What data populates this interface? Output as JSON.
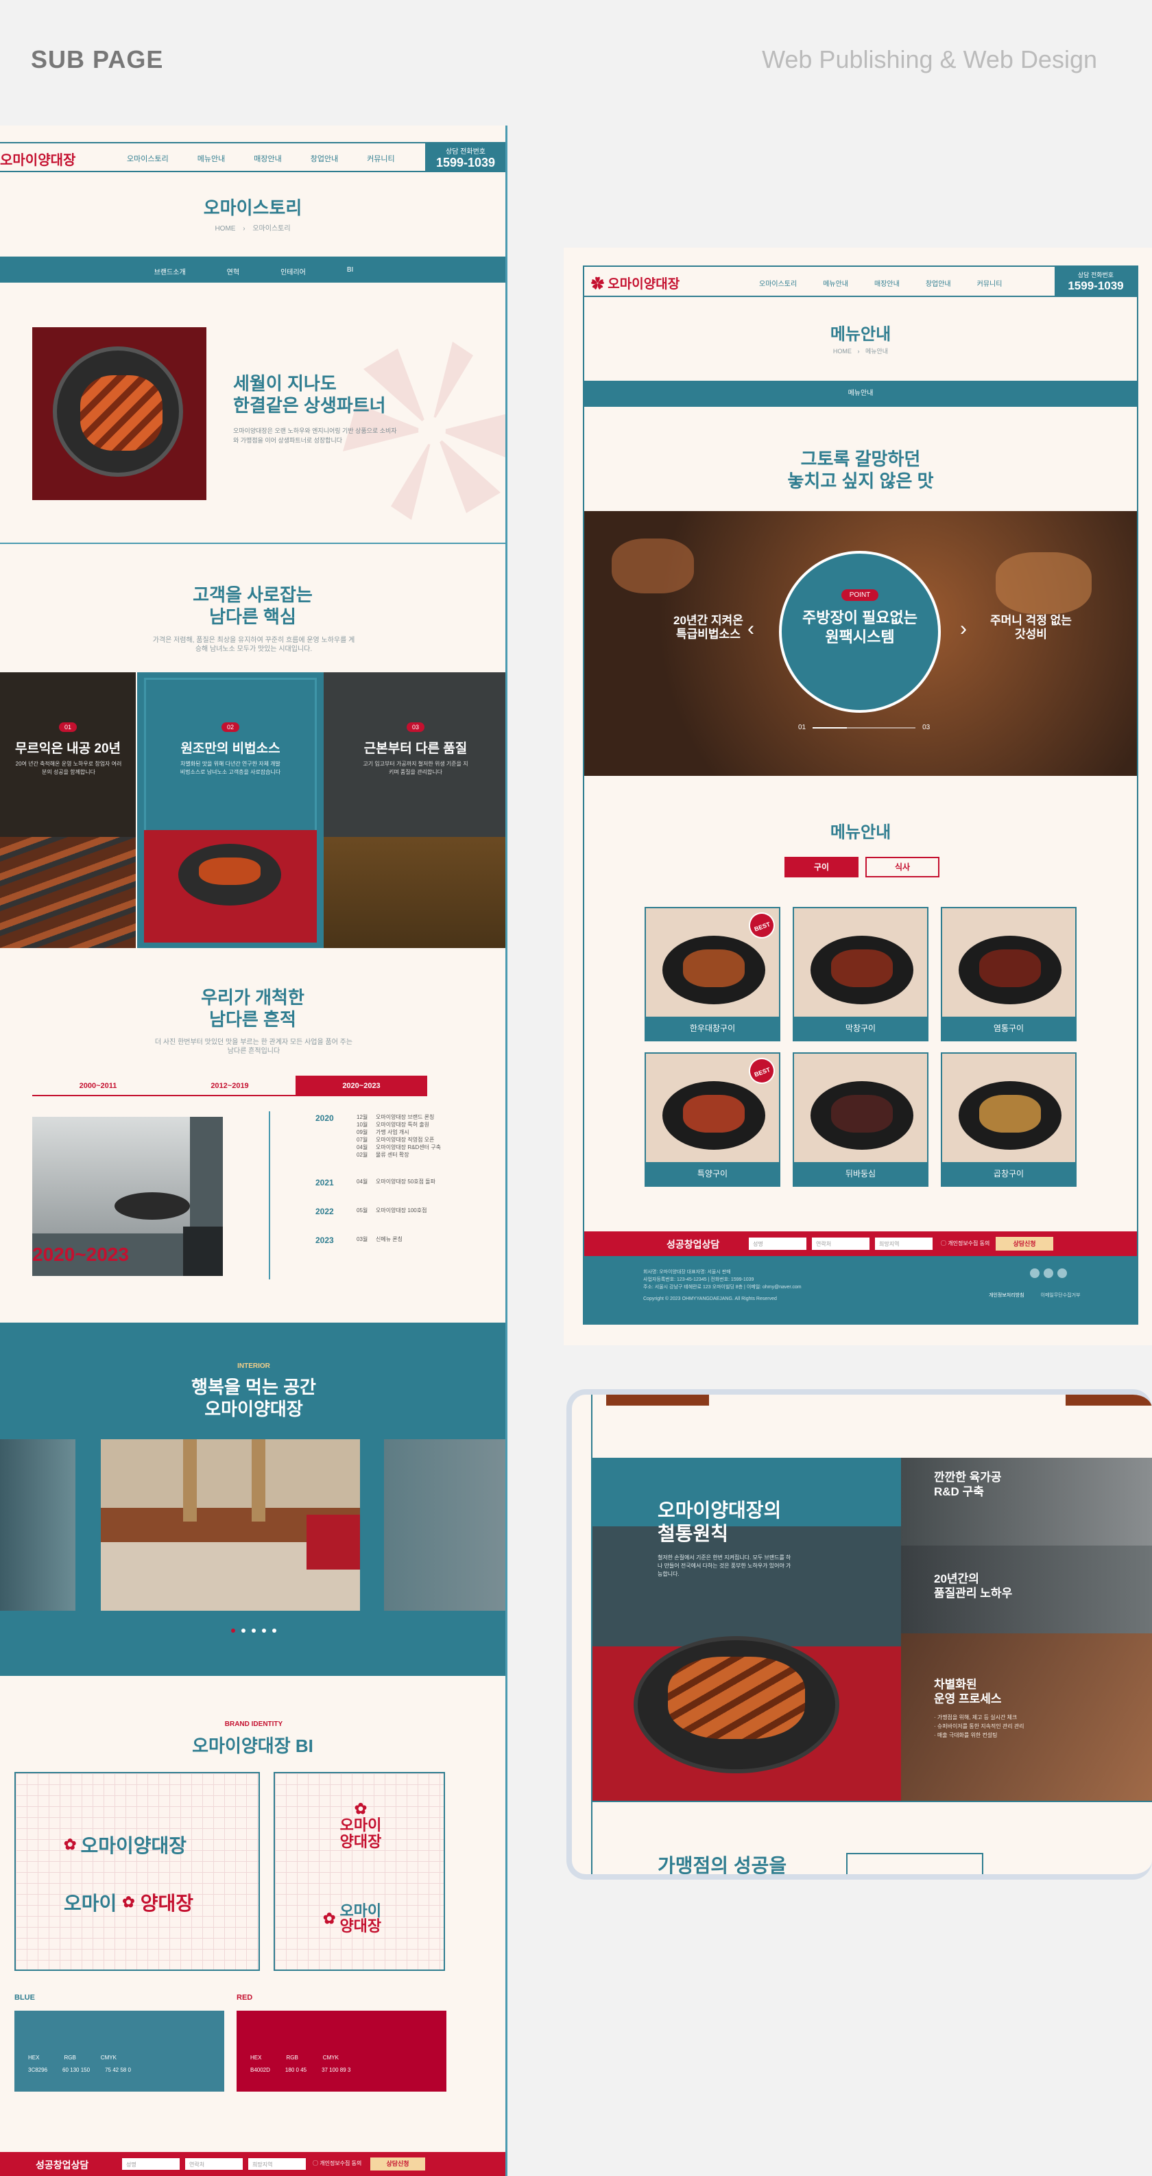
{
  "header": {
    "left": "SUB PAGE",
    "right": "Web Publishing & Web Design"
  },
  "nav": {
    "logo": "오마이양대장",
    "menu": [
      "오마이스토리",
      "메뉴안내",
      "매장안내",
      "창업안내",
      "커뮤니티"
    ],
    "call_label": "상담 전화번호",
    "call_number": "1599-1039"
  },
  "story": {
    "title": "오마이스토리",
    "breadcrumb": [
      "HOME",
      "오마이스토리"
    ],
    "tabs": [
      "브랜드소개",
      "연혁",
      "인테리어",
      "BI"
    ],
    "intro_heading": [
      "세월이 지나도",
      "한결같은 상생파트너"
    ],
    "intro_text": "오마이양대장은 오랜 노하우와 엔지니어링 기반 상품으로 소비자와 가맹점을 이어 상생파트너로 성장합니다"
  },
  "core": {
    "heading": [
      "고객을 사로잡는",
      "남다른 핵심"
    ],
    "desc": "가격은 저렴해, 품질은 최상을 유지하여 꾸준히 흐름에 운영 노하우를 계승해 남녀노소 모두가 맛있는 시대입니다.",
    "cards": [
      {
        "num": "01",
        "title": "무르익은 내공 20년",
        "text": "20여 년간 축적해온 운영 노하우로 창업자 여러분의 성공을 함께합니다"
      },
      {
        "num": "02",
        "title": "원조만의 비법소스",
        "text": "차별화된 맛을 위해 다년간 연구한 자체 개발 비법소스로 남녀노소 고객층을 사로잡습니다"
      },
      {
        "num": "03",
        "title": "근본부터 다른 품질",
        "text": "고기 입고부터 가공까지 철저한 위생 기준을 지키며 품질을 관리합니다"
      }
    ]
  },
  "history": {
    "heading": [
      "우리가 개척한",
      "남다른 흔적"
    ],
    "desc": "더 사진 한번부터 맛있던 맛을 부르는 한 관계자 모든 사업을 품어 주는 남다른 흔적입니다",
    "tabs": [
      "2000~2011",
      "2012~2019",
      "2020~2023"
    ],
    "active_tab": 2,
    "period": "2020~2023",
    "years": [
      {
        "year": "2020",
        "items": [
          {
            "m": "12월",
            "t": "오마이양대장 브랜드 론칭"
          },
          {
            "m": "10월",
            "t": "오마이양대장 특허 출원"
          },
          {
            "m": "09월",
            "t": "가맹 사업 개시"
          },
          {
            "m": "07월",
            "t": "오마이양대장 직영점 오픈"
          },
          {
            "m": "04월",
            "t": "오마이양대장 R&D센터 구축"
          },
          {
            "m": "02월",
            "t": "물류 센터 확장"
          }
        ]
      },
      {
        "year": "2021",
        "items": [
          {
            "m": "04월",
            "t": "오마이양대장 50호점 돌파"
          }
        ]
      },
      {
        "year": "2022",
        "items": [
          {
            "m": "05월",
            "t": "오마이양대장 100호점"
          }
        ]
      },
      {
        "year": "2023",
        "items": [
          {
            "m": "03월",
            "t": "신메뉴 론칭"
          }
        ]
      }
    ]
  },
  "interior": {
    "eyebrow": "INTERIOR",
    "heading": [
      "행복을 먹는 공간",
      "오마이양대장"
    ],
    "dots": 5,
    "active_dot": 0
  },
  "bi": {
    "eyebrow": "BRAND IDENTITY",
    "heading": "오마이양대장 BI",
    "logo_a": "오마이양대장",
    "logo_b1": "오마이",
    "logo_b2": "양대장",
    "logo_v1": "오마이",
    "logo_v2": "양대장",
    "colors": [
      {
        "name": "BLUE",
        "hex_label": "HEX",
        "rgb_label": "RGB",
        "cmyk_label": "CMYK",
        "hex": "3C8296",
        "rgb": "60 130 150",
        "cmyk": "75 42 58 0",
        "swatch": "#3c8296"
      },
      {
        "name": "RED",
        "hex_label": "HEX",
        "rgb_label": "RGB",
        "cmyk_label": "CMYK",
        "hex": "B4002D",
        "rgb": "180 0 45",
        "cmyk": "37 100 89 3",
        "swatch": "#b4002d"
      }
    ]
  },
  "footer_bar": {
    "brand": "성공창업상담",
    "fields": [
      "성명",
      "연락처",
      "희망지역"
    ],
    "agree": "개인정보수집 동의",
    "submit": "상담신청"
  },
  "menu_page": {
    "title": "메뉴안내",
    "breadcrumb": [
      "HOME",
      "메뉴안내"
    ],
    "tab": "메뉴안내",
    "headline": [
      "그토록 갈망하던",
      "놓치고 싶지 않은 맛"
    ],
    "slider": {
      "badge": "POINT",
      "center": [
        "주방장이 필요없는",
        "원팩시스템"
      ],
      "left": [
        "20년간 지켜온",
        "특급비법소스"
      ],
      "right": [
        "주머니 걱정 없는",
        "갓성비"
      ],
      "page_cur": "01",
      "page_total": "03"
    },
    "menu_title": "메뉴안내",
    "menu_tabs": [
      "구이",
      "식사"
    ],
    "items": [
      {
        "name": "한우대창구이",
        "best": true
      },
      {
        "name": "막창구이",
        "best": false
      },
      {
        "name": "염통구이",
        "best": false
      },
      {
        "name": "특양구이",
        "best": true
      },
      {
        "name": "뒤바둥심",
        "best": false
      },
      {
        "name": "곱창구이",
        "best": false
      }
    ],
    "best_label": "BEST",
    "footer": {
      "info": [
        "회사명: 오마이양대장 대표자명: 서울시 판매",
        "사업자등록번호: 123-45-12345 | 전화번호: 1599-1039",
        "주소: 서울시 강남구 테헤란로 123 오마이빌딩 8층 | 이메일: ohmy@naver.com"
      ],
      "copy": "Copyright © 2023 OHMYYANGDAEJANG. All Rights Reserved",
      "links": [
        "개인정보처리방침",
        "이메일무단수집거부"
      ]
    }
  },
  "device": {
    "heading": [
      "오마이양대장의",
      "철통원칙"
    ],
    "text": "철저한 손질에서 기준은 한번 지켜집니다. 모두 브랜드를 하나 만들어 전국에서 다하는 것은 풍부한 노하우가 있어야 가능합니다.",
    "panels": [
      {
        "title": [
          "깐깐한 육가공",
          "R&D 구축"
        ]
      },
      {
        "title": [
          "20년간의",
          "품질관리 노하우"
        ]
      },
      {
        "title": [
          "차별화된",
          "운영 프로세스"
        ],
        "items": [
          "가맹점을 위해, 제고 등 실시간 체크",
          "슈퍼바이저를 통한 지속적인 관리 관리",
          "매출 극대화를 위한 컨설팅"
        ]
      }
    ],
    "bottom": "가맹점의 성공을"
  }
}
